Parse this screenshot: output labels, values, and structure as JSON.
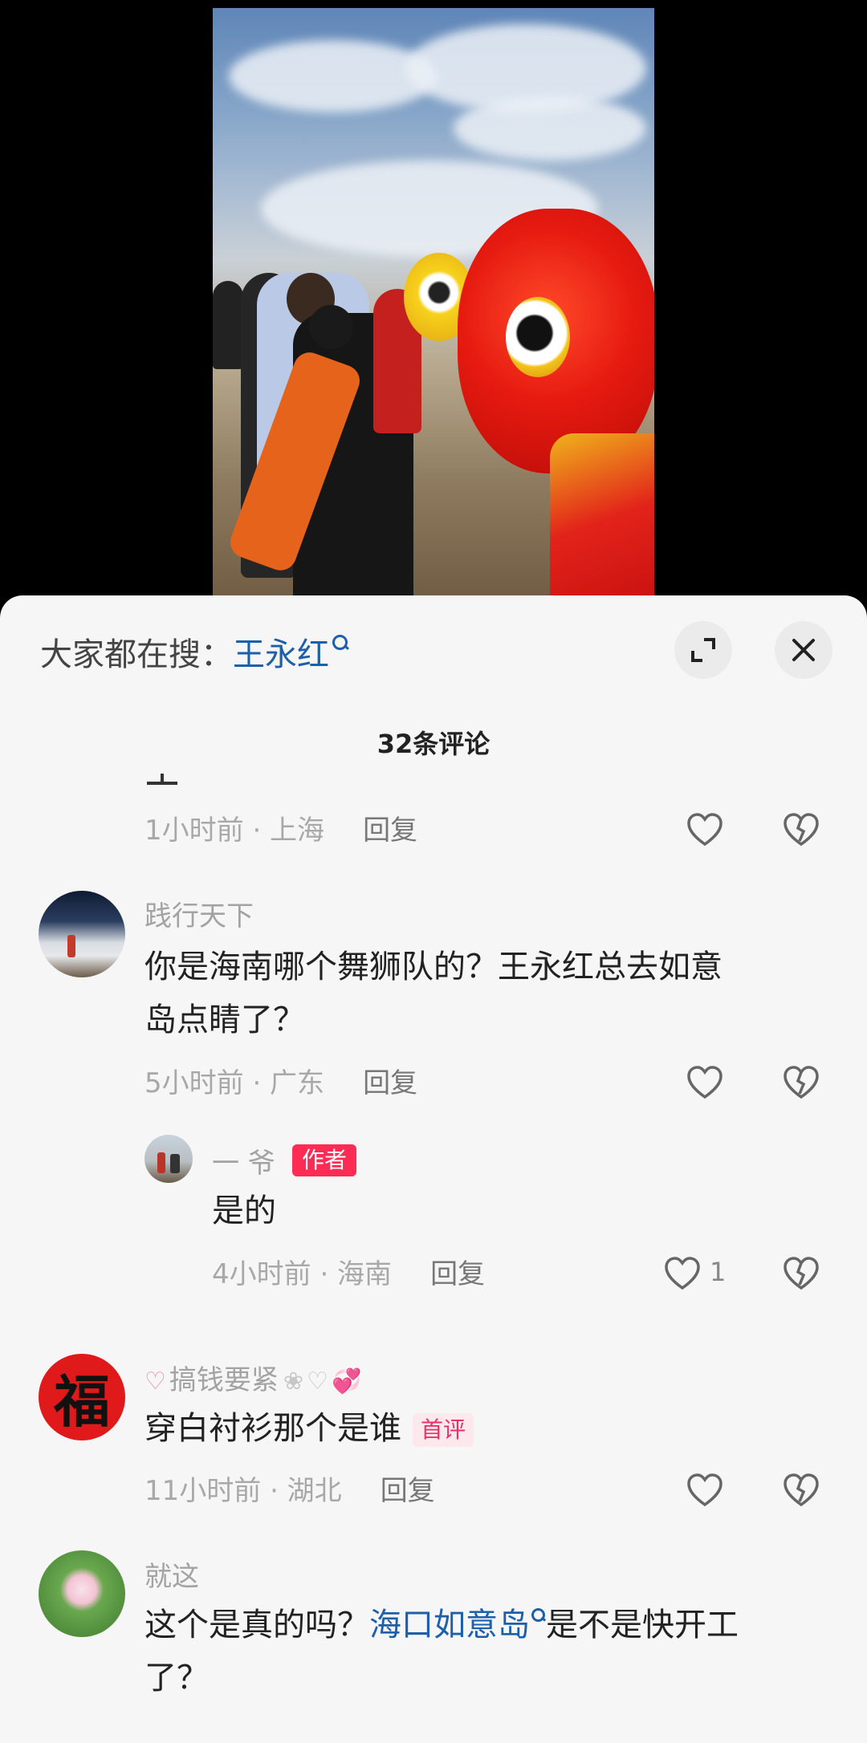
{
  "search": {
    "prefix": "大家都在搜：",
    "term": "王永红"
  },
  "header": {
    "comment_count": "32条评论"
  },
  "comments": [
    {
      "time": "1小时前 · 上海",
      "reply": "回复"
    },
    {
      "username": "践行天下",
      "line1": "你是海南哪个舞狮队的？王永红总去如意",
      "line2": "岛点睛了？",
      "time": "5小时前 · 广东",
      "reply": "回复"
    },
    {
      "username": "一 爷",
      "badge": "作者",
      "text": "是的",
      "time": "4小时前 · 海南",
      "reply": "回复",
      "likes": "1"
    },
    {
      "username": "搞钱要紧",
      "text": "穿白衬衫那个是谁",
      "badge": "首评",
      "time": "11小时前 · 湖北",
      "reply": "回复",
      "avatar_char": "福"
    },
    {
      "username": "就这",
      "line1_a": "这个是真的吗？",
      "line1_link": "海口如意岛",
      "line1_b": "是不是快开工",
      "line2": "了？"
    }
  ],
  "colors": {
    "accent_link": "#1d5fa8",
    "author_badge": "#fe2c55",
    "first_badge_text": "#e8336a"
  }
}
